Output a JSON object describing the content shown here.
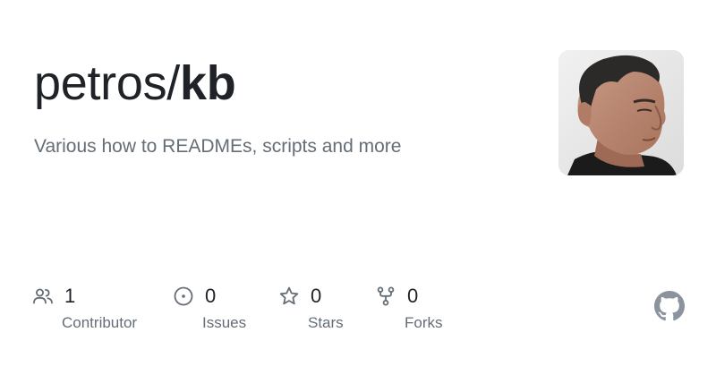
{
  "repo": {
    "owner": "petros/",
    "name": "kb",
    "description": "Various how to READMEs, scripts and more"
  },
  "avatar": {
    "alt": "owner avatar"
  },
  "stats": {
    "contributors": {
      "count": "1",
      "label": "Contributor",
      "icon": "people-icon"
    },
    "issues": {
      "count": "0",
      "label": "Issues",
      "icon": "issue-opened-icon"
    },
    "stars": {
      "count": "0",
      "label": "Stars",
      "icon": "star-icon"
    },
    "forks": {
      "count": "0",
      "label": "Forks",
      "icon": "repo-forked-icon"
    }
  },
  "brand": {
    "logo": "github-mark-icon",
    "icon_color": "#656d76",
    "logo_color": "#8b949e"
  }
}
